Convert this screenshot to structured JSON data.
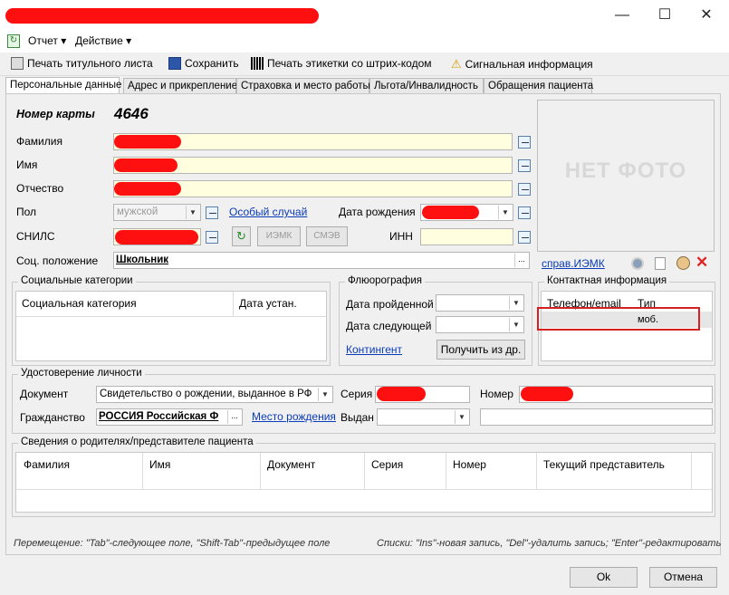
{
  "window": {
    "title_controls": {
      "minimize": "—",
      "maximize": "☐",
      "close": "✕"
    }
  },
  "menu": {
    "report": "Отчет ▾",
    "action": "Действие ▾"
  },
  "toolbar": {
    "print_title": "Печать титульного листа",
    "save": "Сохранить",
    "print_barcode": "Печать этикетки со штрих-кодом",
    "signal_info": "Сигнальная информация"
  },
  "tabs": [
    "Персональные данные",
    "Адрес и прикрепление",
    "Страховка и место работы",
    "Льгота/Инвалидность",
    "Обращения пациента"
  ],
  "form": {
    "card_number_label": "Номер карты",
    "card_number": "4646",
    "surname_label": "Фамилия",
    "name_label": "Имя",
    "patronymic_label": "Отчество",
    "sex_label": "Пол",
    "sex_value": "мужской",
    "special_case": "Особый случай",
    "birth_date_label": "Дата рождения",
    "snils_label": "СНИЛС",
    "izmk_button": "ИЭМК",
    "smev_button": "СМЭВ",
    "inn_label": "ИНН",
    "social_status_label": "Соц. положение",
    "social_status_value": "Школьник",
    "photo_placeholder": "НЕТ ФОТО",
    "izmk_ref": "справ.ИЭМК"
  },
  "social": {
    "title": "Социальные категории",
    "col_category": "Социальная категория",
    "col_date": "Дата устан."
  },
  "fluoro": {
    "title": "Флюорография",
    "passed_label": "Дата пройденной",
    "next_label": "Дата следующей",
    "contingent": "Контингент",
    "get_button": "Получить из др."
  },
  "contacts": {
    "title": "Контактная информация",
    "col_phone": "Телефон/email",
    "col_type": "Тип",
    "row_type": "моб."
  },
  "identity": {
    "title": "Удостоверение личности",
    "doc_label": "Документ",
    "doc_value": "Свидетельство о рождении, выданное в РФ",
    "series_label": "Серия",
    "number_label": "Номер",
    "citizenship_label": "Гражданство",
    "citizenship_value": "РОССИЯ Российская Ф",
    "birthplace": "Место рождения",
    "issued_label": "Выдан"
  },
  "parents": {
    "title": "Сведения о родителях/представителе пациента",
    "columns": [
      "Фамилия",
      "Имя",
      "Документ",
      "Серия",
      "Номер",
      "Текущий представитель"
    ]
  },
  "hints": {
    "left": "Перемещение: \"Tab\"-следующее поле, \"Shift-Tab\"-предыдущее поле",
    "right": "Списки: \"Ins\"-новая запись, \"Del\"-удалить запись; \"Enter\"-редактировать"
  },
  "buttons": {
    "ok": "Ok",
    "cancel": "Отмена"
  }
}
